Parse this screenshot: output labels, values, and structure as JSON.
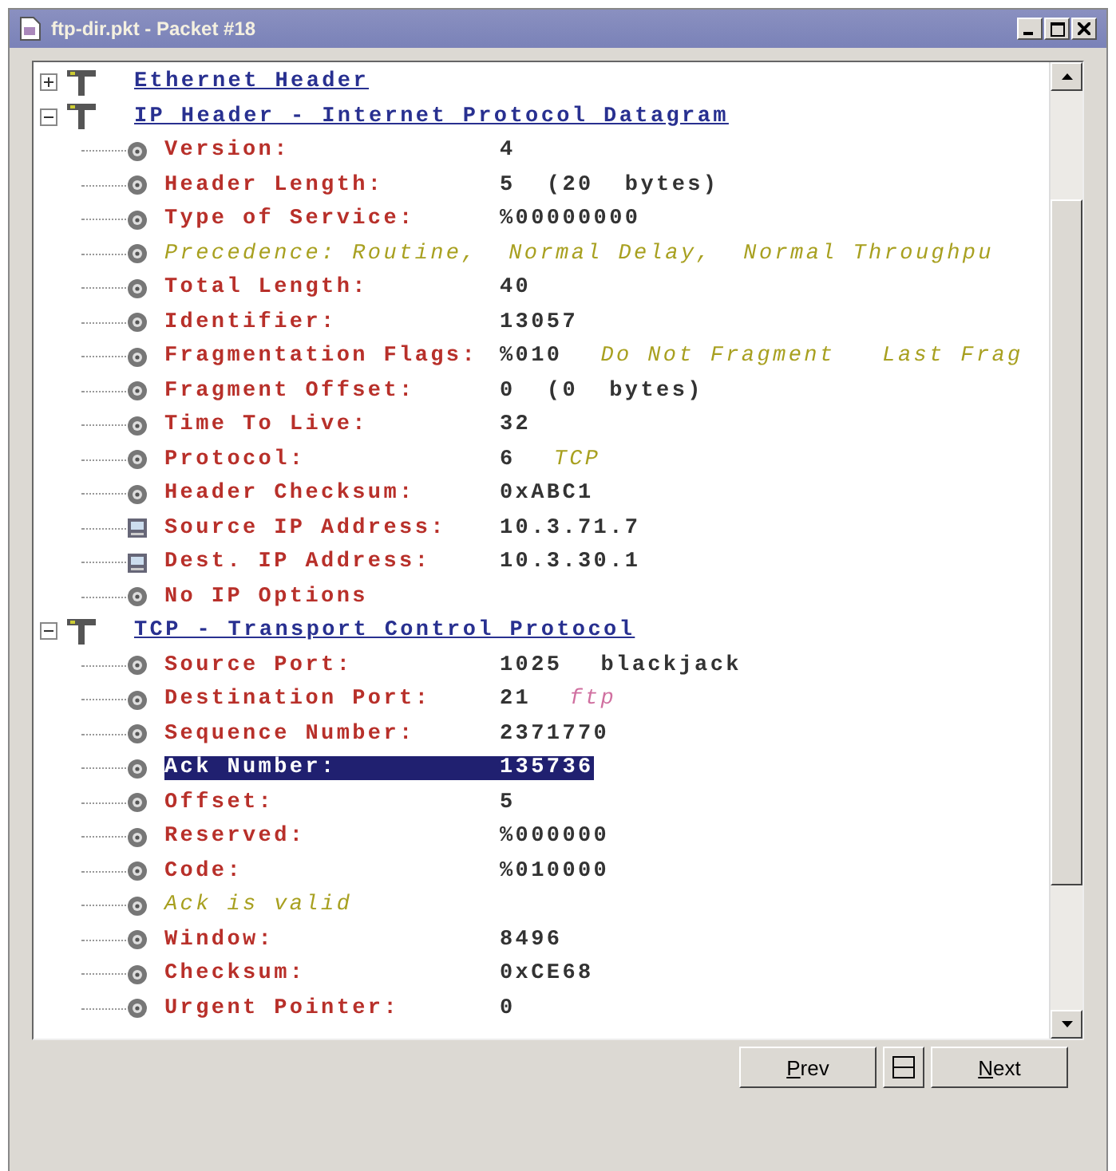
{
  "window": {
    "title": "ftp-dir.pkt - Packet #18"
  },
  "tree": [
    {
      "title": "Ethernet Header",
      "expanded": false
    },
    {
      "title": "IP Header - Internet Protocol Datagram",
      "expanded": true,
      "children": [
        {
          "kind": "field",
          "label": "Version:",
          "value": "4",
          "selected": false
        },
        {
          "kind": "field",
          "label": "Header Length:",
          "value": "5  (20  bytes)",
          "selected": false
        },
        {
          "kind": "field",
          "label": "Type of Service:",
          "value": "%00000000",
          "selected": false
        },
        {
          "kind": "info",
          "text": "Precedence: Routine,  Normal Delay,  Normal Throughpu",
          "selected": false
        },
        {
          "kind": "field",
          "label": "Total Length:",
          "value": "40",
          "selected": false
        },
        {
          "kind": "field",
          "label": "Identifier:",
          "value": "13057",
          "selected": false
        },
        {
          "kind": "field",
          "label": "Fragmentation Flags:",
          "value": "%010",
          "note": {
            "kind": "comment",
            "text": "Do Not Fragment   Last Frag"
          },
          "selected": false
        },
        {
          "kind": "field",
          "label": "Fragment Offset:",
          "value": "0  (0  bytes)",
          "selected": false
        },
        {
          "kind": "field",
          "label": "Time To Live:",
          "value": "32",
          "selected": false
        },
        {
          "kind": "field",
          "label": "Protocol:",
          "value": "6",
          "note": {
            "kind": "comment",
            "text": "TCP"
          },
          "selected": false
        },
        {
          "kind": "field",
          "label": "Header Checksum:",
          "value": "0xABC1",
          "selected": false
        },
        {
          "kind": "address",
          "label": "Source IP Address:",
          "value": "10.3.71.7",
          "selected": false
        },
        {
          "kind": "address",
          "label": "Dest. IP Address:",
          "value": "10.3.30.1",
          "selected": false
        },
        {
          "kind": "field",
          "label": "No IP Options",
          "selected": false
        }
      ]
    },
    {
      "title": "TCP - Transport Control Protocol",
      "expanded": true,
      "children": [
        {
          "kind": "field",
          "label": "Source Port:",
          "value": "1025",
          "note": {
            "kind": "name",
            "text": "blackjack"
          },
          "selected": false
        },
        {
          "kind": "field",
          "label": "Destination Port:",
          "value": "21",
          "note": {
            "kind": "service",
            "text": "ftp"
          },
          "selected": false
        },
        {
          "kind": "field",
          "label": "Sequence Number:",
          "value": "2371770",
          "selected": false
        },
        {
          "kind": "field",
          "label": "Ack Number:",
          "value": "135736",
          "selected": true
        },
        {
          "kind": "field",
          "label": "Offset:",
          "value": "5",
          "selected": false
        },
        {
          "kind": "field",
          "label": "Reserved:",
          "value": "%000000",
          "selected": false
        },
        {
          "kind": "field",
          "label": "Code:",
          "value": "%010000",
          "selected": false
        },
        {
          "kind": "info",
          "text": "Ack is valid",
          "selected": false
        },
        {
          "kind": "field",
          "label": "Window:",
          "value": "8496",
          "selected": false
        },
        {
          "kind": "field",
          "label": "Checksum:",
          "value": "0xCE68",
          "selected": false
        },
        {
          "kind": "field",
          "label": "Urgent Pointer:",
          "value": "0",
          "selected": false
        }
      ]
    }
  ],
  "buttons": {
    "prev": "Prev",
    "next": "Next"
  }
}
